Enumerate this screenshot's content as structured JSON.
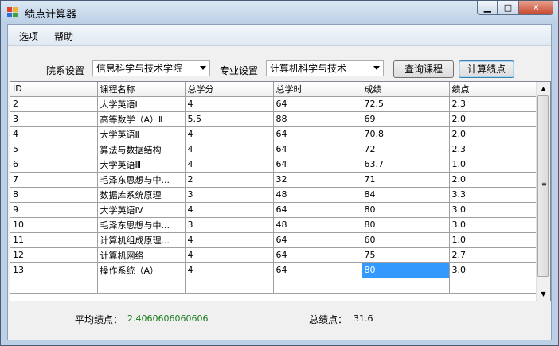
{
  "window": {
    "title": "绩点计算器",
    "min": "▭",
    "max": "□",
    "close": "✕"
  },
  "menu": [
    "选项",
    "帮助"
  ],
  "toolbar": {
    "dept_label": "院系设置",
    "dept_value": "信息科学与技术学院",
    "major_label": "专业设置",
    "major_value": "计算机科学与技术",
    "query_button": "查询课程",
    "calc_button": "计算绩点"
  },
  "table": {
    "columns": [
      "ID",
      "课程名称",
      "总学分",
      "总学时",
      "成绩",
      "绩点"
    ],
    "rows": [
      [
        "2",
        "大学英语Ⅰ",
        "4",
        "64",
        "72.5",
        "2.3"
      ],
      [
        "3",
        "高等数学（A）Ⅱ",
        "5.5",
        "88",
        "69",
        "2.0"
      ],
      [
        "4",
        "大学英语Ⅱ",
        "4",
        "64",
        "70.8",
        "2.0"
      ],
      [
        "5",
        "算法与数据结构",
        "4",
        "64",
        "72",
        "2.3"
      ],
      [
        "6",
        "大学英语Ⅲ",
        "4",
        "64",
        "63.7",
        "1.0"
      ],
      [
        "7",
        "毛泽东思想与中...",
        "2",
        "32",
        "71",
        "2.0"
      ],
      [
        "8",
        "数据库系统原理",
        "3",
        "48",
        "84",
        "3.3"
      ],
      [
        "9",
        "大学英语Ⅳ",
        "4",
        "64",
        "80",
        "3.0"
      ],
      [
        "10",
        "毛泽东思想与中...",
        "3",
        "48",
        "80",
        "3.0"
      ],
      [
        "11",
        "计算机组成原理...",
        "4",
        "64",
        "60",
        "1.0"
      ],
      [
        "12",
        "计算机网络",
        "4",
        "64",
        "75",
        "2.7"
      ],
      [
        "13",
        "操作系统（A）",
        "4",
        "64",
        "80",
        "3.0"
      ]
    ]
  },
  "summary": {
    "avg_label": "平均绩点：",
    "avg_value": "2.4060606060606",
    "total_label": "总绩点：",
    "total_value": "31.6"
  },
  "colors": {
    "selection": "#3399ff",
    "avg_value": "#1a7a1a"
  }
}
